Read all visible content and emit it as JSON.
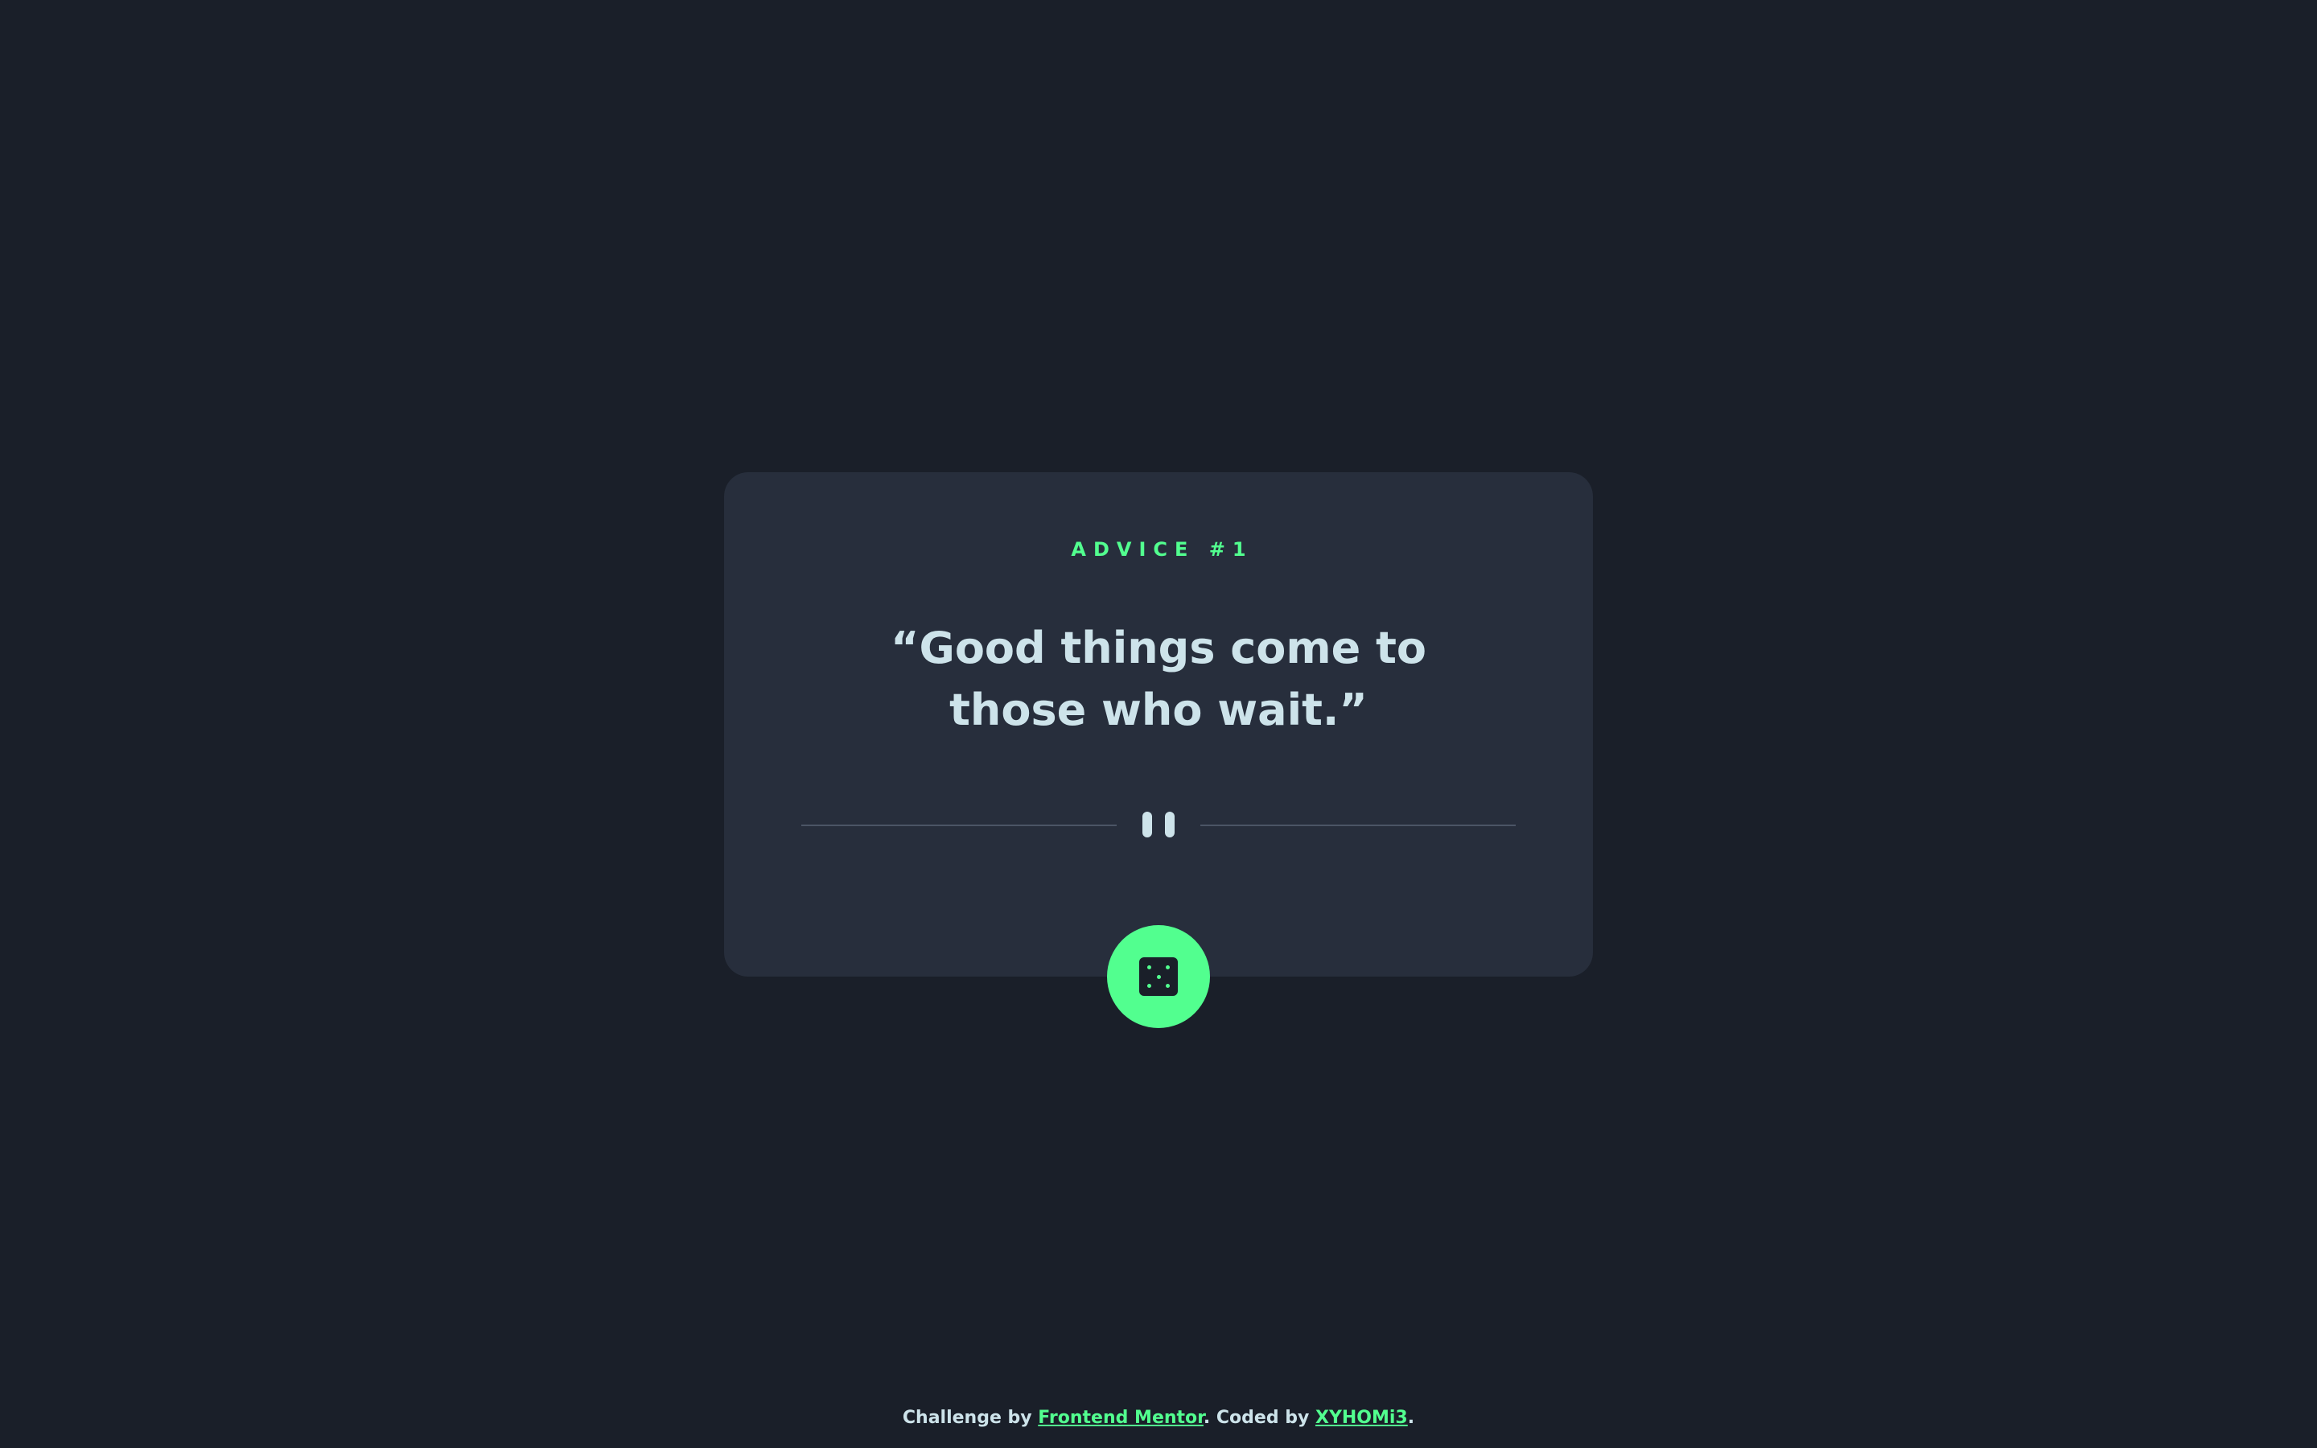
{
  "colors": {
    "background": "#1a1f29",
    "card": "#272e3c",
    "accent": "#52ff8f",
    "text": "#cde3ea",
    "divider": "#4b5565"
  },
  "card": {
    "advice_label": "ADVICE #1",
    "quote": "“Good things come to those who wait.”",
    "divider_icon": "pause-icon"
  },
  "dice_button": {
    "icon": "dice-icon",
    "aria_label": "Get new advice"
  },
  "footer": {
    "prefix": "Challenge by ",
    "challenge_link": "Frontend Mentor",
    "middle": ". Coded by ",
    "author_link": "XYHOMi3",
    "suffix": "."
  }
}
